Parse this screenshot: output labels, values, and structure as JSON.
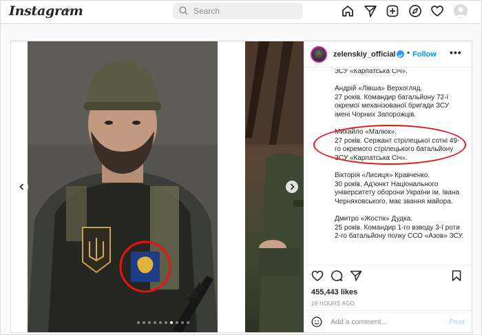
{
  "nav": {
    "logo": "Instagram",
    "search_placeholder": "Search",
    "icons": [
      "home-icon",
      "direct-icon",
      "new-post-icon",
      "explore-icon",
      "activity-icon",
      "profile-avatar"
    ]
  },
  "post": {
    "username": "zelenskiy_official",
    "bullet": "•",
    "follow": "Follow",
    "more": "•••",
    "caption": [
      "ЗСУ «Карпатська Січ».",
      "Андрій «Лівша» Верхогляд.\n27 років. Командир батальйону 72-ї окремої механізованої бригади ЗСУ імені Чорних Запорожців.",
      "Михайло «Малюк».\n27 років. Сержант стрілецької сотні 49-го окремого стрілецького батальйону ЗСУ «Карпатська Січ».",
      "Вікторія «Лисиця» Кравченко.\n30 років. Ад'юнкт Національного університету оборони України ім. Івана Черняховського, має звання майора.",
      "Дмитро «Жостік» Дудка.\n25 років. Командир 1-го взводу 3-ї роти 2-го батальйону полку ССО «Азов» ЗСУ."
    ],
    "likes": "455,443 likes",
    "time_ago": "19 HOURS AGO",
    "comment_placeholder": "Add a comment...",
    "post_button": "Post",
    "carousel_dots": 10,
    "carousel_active": 6
  },
  "colors": {
    "accent": "#0095f6",
    "highlight_circle": "#ee1111"
  }
}
